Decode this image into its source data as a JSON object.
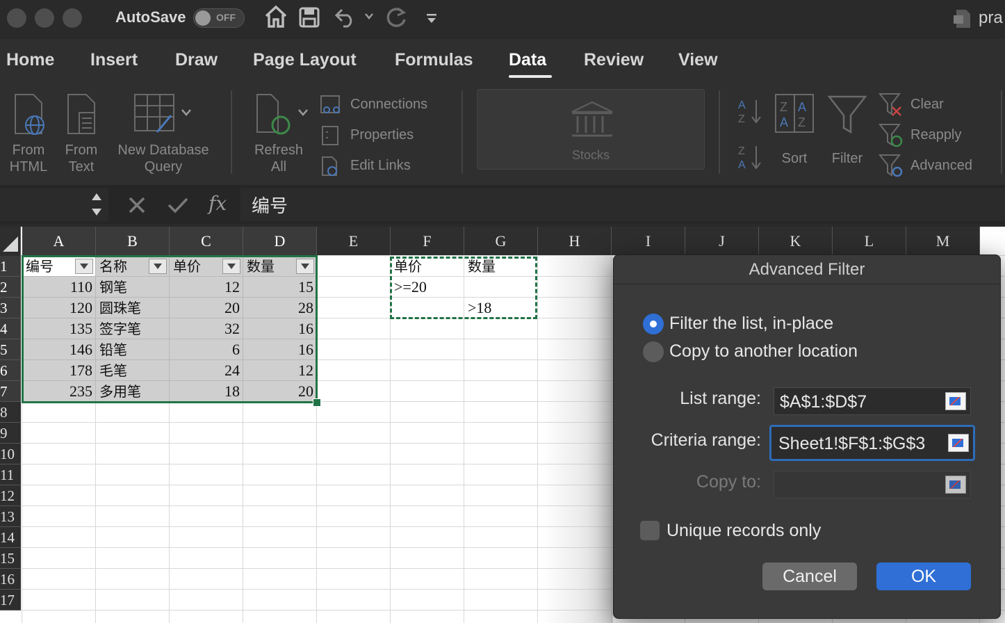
{
  "titlebar": {
    "autosave_label": "AutoSave",
    "autosave_state": "OFF",
    "doc_title": "pra"
  },
  "tabs": [
    "Home",
    "Insert",
    "Draw",
    "Page Layout",
    "Formulas",
    "Data",
    "Review",
    "View"
  ],
  "active_tab": "Data",
  "ribbon": {
    "from_html": [
      "From",
      "HTML"
    ],
    "from_text": [
      "From",
      "Text"
    ],
    "new_db_query": [
      "New Database",
      "Query"
    ],
    "refresh_all": [
      "Refresh",
      "All"
    ],
    "connections": "Connections",
    "properties": "Properties",
    "edit_links": "Edit Links",
    "stocks": "Stocks",
    "sort": "Sort",
    "filter": "Filter",
    "clear": "Clear",
    "reapply": "Reapply",
    "advanced": "Advanced"
  },
  "formula_bar": {
    "cancel_icon": "x-icon",
    "enter_icon": "check-icon",
    "fx_label": "fx",
    "content": "编号"
  },
  "sheet": {
    "columns": [
      "A",
      "B",
      "C",
      "D",
      "E",
      "F",
      "G",
      "H",
      "I",
      "J",
      "K",
      "L",
      "M"
    ],
    "rows": [
      "1",
      "2",
      "3",
      "4",
      "5",
      "6",
      "7",
      "8",
      "9",
      "10",
      "11",
      "12",
      "13",
      "14",
      "15",
      "16",
      "17"
    ],
    "table_headers": [
      "编号",
      "名称",
      "单价",
      "数量"
    ],
    "table_rows": [
      [
        "110",
        "钢笔",
        "12",
        "15"
      ],
      [
        "120",
        "圆珠笔",
        "20",
        "28"
      ],
      [
        "135",
        "签字笔",
        "32",
        "16"
      ],
      [
        "146",
        "铅笔",
        "6",
        "16"
      ],
      [
        "178",
        "毛笔",
        "24",
        "12"
      ],
      [
        "235",
        "多用笔",
        "18",
        "20"
      ]
    ],
    "criteria": {
      "f1": "单价",
      "g1": "数量",
      "f2": ">=20",
      "g3": ">18"
    }
  },
  "dialog": {
    "title": "Advanced Filter",
    "option_filter_inplace": "Filter the list, in-place",
    "option_copy": "Copy to another location",
    "selected_option": "Filter the list, in-place",
    "list_range_label": "List range:",
    "list_range_value": "$A$1:$D$7",
    "criteria_range_label": "Criteria range:",
    "criteria_range_value": "Sheet1!$F$1:$G$3",
    "copy_to_label": "Copy to:",
    "copy_to_value": "",
    "unique_label": "Unique records only",
    "unique_checked": false,
    "cancel_label": "Cancel",
    "ok_label": "OK"
  }
}
